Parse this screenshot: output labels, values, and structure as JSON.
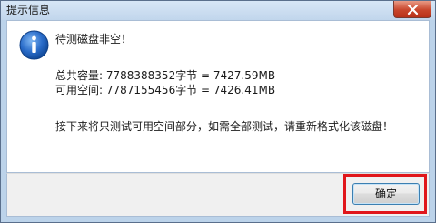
{
  "window": {
    "title": "提示信息"
  },
  "icons": {
    "close": "close-icon",
    "info": "info-icon"
  },
  "message": {
    "title": "待测磁盘非空！",
    "total_capacity": "总共容量: 7788388352字节 = 7427.59MB",
    "free_space": "可用空间: 7787155456字节 = 7426.41MB",
    "note": "接下来将只测试可用空间部分，如需全部测试，请重新格式化该磁盘！"
  },
  "buttons": {
    "ok_label": "确定"
  },
  "colors": {
    "highlight": "#e0161b",
    "close_button": "#c8462c",
    "info_icon": "#2a6cc9"
  }
}
